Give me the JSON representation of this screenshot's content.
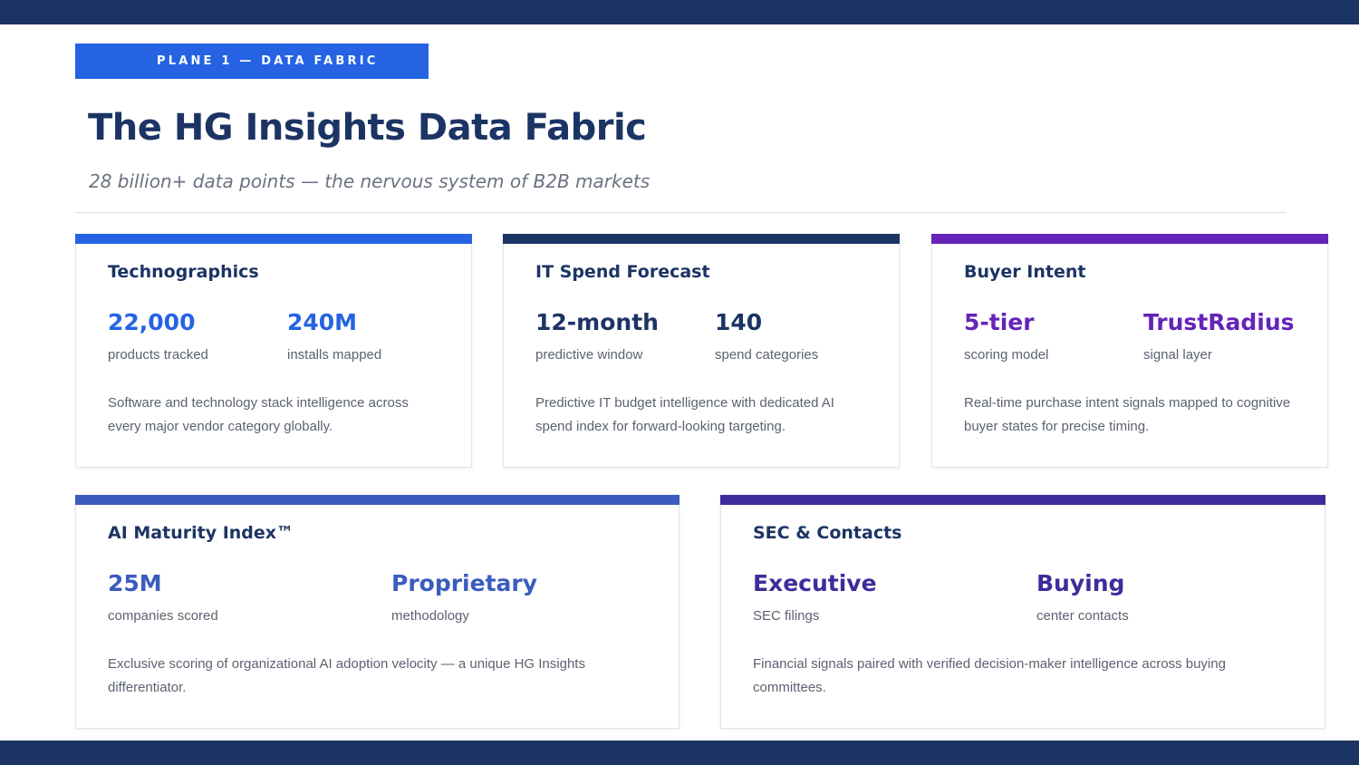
{
  "badge": {
    "label": "PLANE 1 — DATA FABRIC"
  },
  "header": {
    "title": "The HG Insights Data Fabric",
    "subtitle": "28 billion+ data points — the nervous system of B2B markets"
  },
  "colors": {
    "navy": "#1c3464",
    "blue": "#2563e3",
    "purple": "#6523b8",
    "steel_blue": "#3b5bbf",
    "indigo": "#3c2d9a"
  },
  "cards": [
    {
      "title": "Technographics",
      "stats": [
        {
          "value": "22,000",
          "label": "products tracked"
        },
        {
          "value": "240M",
          "label": "installs mapped"
        }
      ],
      "description": "Software and technology stack intelligence across every major vendor category globally."
    },
    {
      "title": "IT Spend Forecast",
      "stats": [
        {
          "value": "12-month",
          "label": "predictive window"
        },
        {
          "value": "140",
          "label": "spend categories"
        }
      ],
      "description": "Predictive IT budget intelligence with dedicated AI spend index for forward-looking targeting."
    },
    {
      "title": "Buyer Intent",
      "stats": [
        {
          "value": "5-tier",
          "label": "scoring model"
        },
        {
          "value": "TrustRadius",
          "label": "signal layer"
        }
      ],
      "description": "Real-time purchase intent signals mapped to cognitive buyer states for precise timing."
    },
    {
      "title": "AI Maturity Index™",
      "stats": [
        {
          "value": "25M",
          "label": "companies scored"
        },
        {
          "value": "Proprietary",
          "label": "methodology"
        }
      ],
      "description": "Exclusive scoring of organizational AI adoption velocity — a unique HG Insights differentiator."
    },
    {
      "title": "SEC & Contacts",
      "stats": [
        {
          "value": "Executive",
          "label": "SEC filings"
        },
        {
          "value": "Buying",
          "label": "center contacts"
        }
      ],
      "description": "Financial signals paired with verified decision-maker intelligence across buying committees."
    }
  ]
}
